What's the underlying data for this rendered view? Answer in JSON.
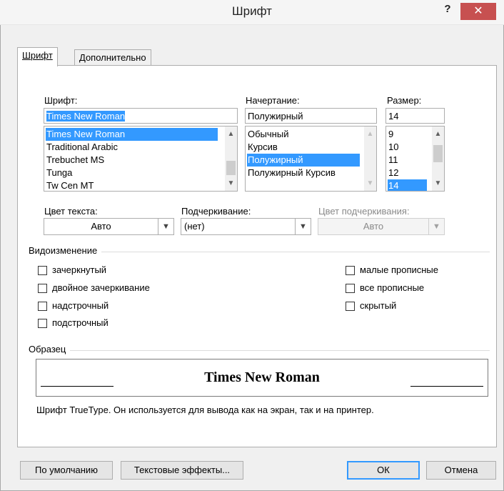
{
  "window": {
    "title": "Шрифт",
    "help_label": "?",
    "close_label": "✕"
  },
  "tabs": [
    {
      "label": "Шрифт"
    },
    {
      "label": "Дополнительно"
    }
  ],
  "font": {
    "label": "Шрифт:",
    "value": "Times New Roman",
    "items": [
      {
        "label": "Times New Roman",
        "selected": true
      },
      {
        "label": "Traditional Arabic"
      },
      {
        "label": "Trebuchet MS"
      },
      {
        "label": "Tunga"
      },
      {
        "label": "Tw Cen MT"
      }
    ]
  },
  "style": {
    "label": "Начертание:",
    "value": "Полужирный",
    "items": [
      {
        "label": "Обычный"
      },
      {
        "label": "Курсив"
      },
      {
        "label": "Полужирный",
        "selected": true
      },
      {
        "label": "Полужирный Курсив"
      }
    ]
  },
  "size": {
    "label": "Размер:",
    "value": "14",
    "items": [
      {
        "label": "9"
      },
      {
        "label": "10"
      },
      {
        "label": "11"
      },
      {
        "label": "12"
      },
      {
        "label": "14",
        "selected": true
      }
    ]
  },
  "text_color": {
    "label": "Цвет текста:",
    "value": "Авто"
  },
  "underline": {
    "label": "Подчеркивание:",
    "value": "(нет)"
  },
  "underline_color": {
    "label": "Цвет подчеркивания:",
    "value": "Авто"
  },
  "effects": {
    "title": "Видоизменение",
    "left": [
      {
        "label": "зачеркнутый",
        "checked": false
      },
      {
        "label": "двойное зачеркивание",
        "checked": false
      },
      {
        "label": "надстрочный",
        "checked": false
      },
      {
        "label": "подстрочный",
        "checked": false
      }
    ],
    "right": [
      {
        "label": "малые прописные",
        "checked": false
      },
      {
        "label": "все прописные",
        "checked": false
      },
      {
        "label": "скрытый",
        "checked": false
      }
    ]
  },
  "preview": {
    "title": "Образец",
    "sample_text": "Times New Roman",
    "description": "Шрифт TrueType. Он используется для вывода как на экран, так и на принтер."
  },
  "buttons": {
    "default": "По умолчанию",
    "text_effects": "Текстовые эффекты...",
    "ok": "ОК",
    "cancel": "Отмена"
  },
  "colors": {
    "selection": "#3399ff",
    "close_button": "#c75050"
  }
}
